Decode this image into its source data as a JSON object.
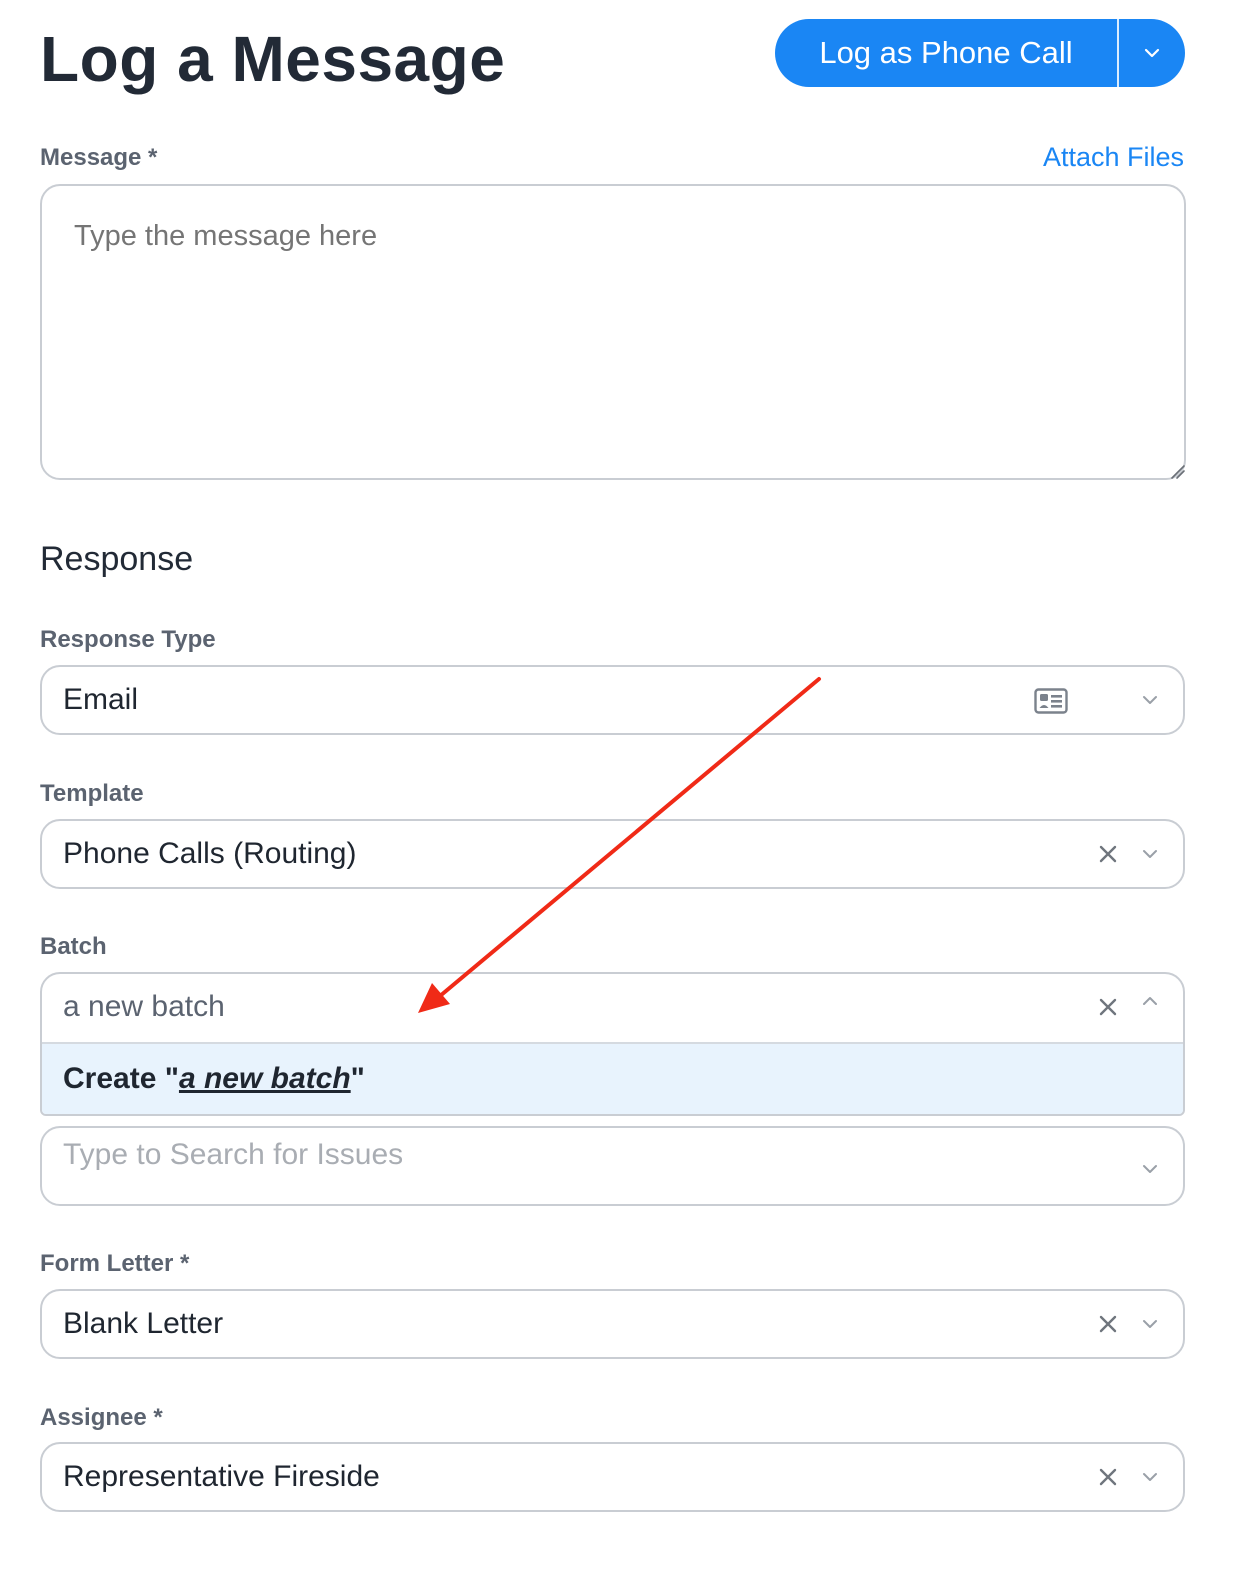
{
  "header": {
    "title": "Log a Message",
    "primary_button": "Log as Phone Call"
  },
  "message": {
    "label": "Message *",
    "attach_link": "Attach Files",
    "placeholder": "Type the message here"
  },
  "response": {
    "section_title": "Response",
    "response_type": {
      "label": "Response Type",
      "value": "Email"
    },
    "template": {
      "label": "Template",
      "value": "Phone Calls (Routing)"
    },
    "batch": {
      "label": "Batch",
      "input_value": "a new batch",
      "option_prefix": "Create \"",
      "option_query": "a new batch",
      "option_suffix": "\""
    },
    "issues": {
      "placeholder": "Type to Search for Issues"
    },
    "form_letter": {
      "label": "Form Letter *",
      "value": "Blank Letter"
    },
    "assignee": {
      "label": "Assignee *",
      "value": "Representative Fireside"
    }
  },
  "icons": {
    "caret": "chevron-down-icon",
    "caret_up": "chevron-up-icon",
    "clear": "close-icon",
    "card": "contact-card-icon"
  },
  "colors": {
    "accent": "#1a86f4",
    "annotation_arrow": "#f02a17",
    "option_highlight": "#e8f3fd"
  }
}
